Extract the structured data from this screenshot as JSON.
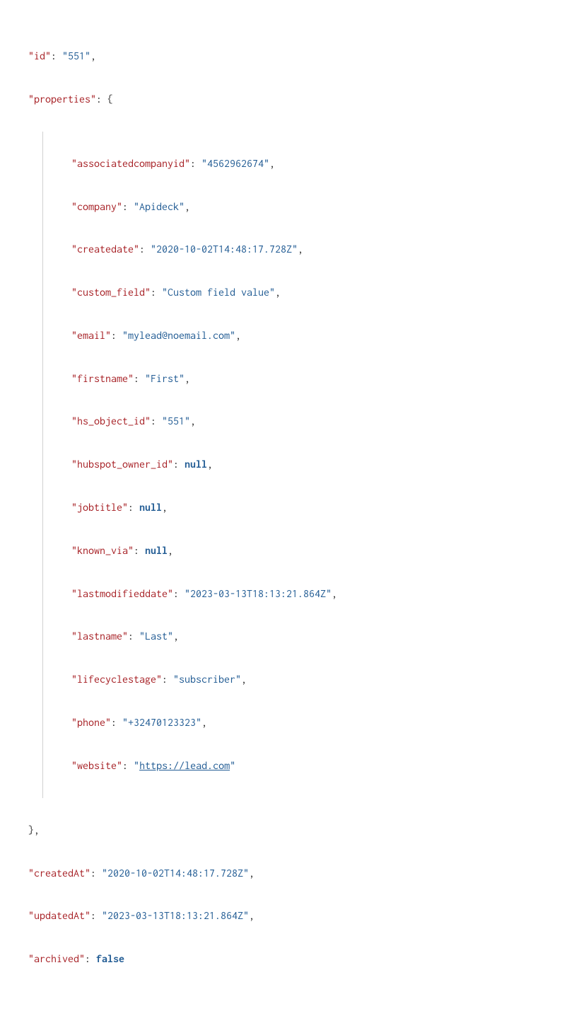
{
  "json": {
    "id": {
      "key": "\"id\"",
      "value": "\"551\""
    },
    "properties_key": "\"properties\"",
    "properties": {
      "associatedcompanyid": {
        "key": "\"associatedcompanyid\"",
        "value": "\"4562962674\""
      },
      "company": {
        "key": "\"company\"",
        "value": "\"Apideck\""
      },
      "createdate": {
        "key": "\"createdate\"",
        "value": "\"2020-10-02T14:48:17.728Z\""
      },
      "custom_field": {
        "key": "\"custom_field\"",
        "value": "\"Custom field value\""
      },
      "email": {
        "key": "\"email\"",
        "value": "\"mylead@noemail.com\""
      },
      "firstname": {
        "key": "\"firstname\"",
        "value": "\"First\""
      },
      "hs_object_id": {
        "key": "\"hs_object_id\"",
        "value": "\"551\""
      },
      "hubspot_owner_id": {
        "key": "\"hubspot_owner_id\"",
        "value": "null"
      },
      "jobtitle": {
        "key": "\"jobtitle\"",
        "value": "null"
      },
      "known_via": {
        "key": "\"known_via\"",
        "value": "null"
      },
      "lastmodifieddate": {
        "key": "\"lastmodifieddate\"",
        "value": "\"2023-03-13T18:13:21.864Z\""
      },
      "lastname": {
        "key": "\"lastname\"",
        "value": "\"Last\""
      },
      "lifecyclestage": {
        "key": "\"lifecyclestage\"",
        "value": "\"subscriber\""
      },
      "phone": {
        "key": "\"phone\"",
        "value": "\"+32470123323\""
      },
      "website": {
        "key": "\"website\"",
        "value_prefix": "\"",
        "value_url": "https://lead.com",
        "value_suffix": "\""
      }
    },
    "createdAt": {
      "key": "\"createdAt\"",
      "value": "\"2020-10-02T14:48:17.728Z\""
    },
    "updatedAt": {
      "key": "\"updatedAt\"",
      "value": "\"2023-03-13T18:13:21.864Z\""
    },
    "archived": {
      "key": "\"archived\"",
      "value": "false"
    }
  },
  "punct": {
    "colon": ":",
    "comma": ",",
    "open_brace": "{",
    "close_brace": "}",
    "close_brace_comma": "},"
  }
}
